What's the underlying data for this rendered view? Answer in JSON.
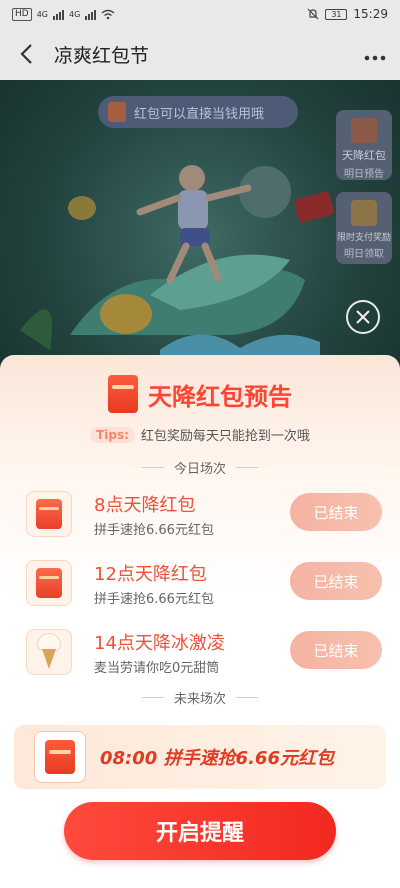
{
  "status_bar": {
    "network_badge": "HD",
    "sim_a": "4G",
    "sim_b": "4G",
    "battery": "31",
    "time": "15:29"
  },
  "navbar": {
    "title": "凉爽红包节",
    "more_icon": "ellipsis-icon",
    "back_icon": "chevron-left-icon"
  },
  "banner": {
    "pill_text": "红包可以直接当钱用哦",
    "side_cards": [
      {
        "line1": "天降红包",
        "line2": "明日预告"
      },
      {
        "line1": "限时支付奖励",
        "line2": "明日领取"
      }
    ]
  },
  "sheet": {
    "title": "天降红包预告",
    "tips_tag": "Tips:",
    "tips_text": "红包奖励每天只能抢到一次哦",
    "today_label": "今日场次",
    "future_label": "未来场次",
    "sessions": [
      {
        "name": "8点天降红包",
        "sub": "拼手速抢6.66元红包",
        "button": "已结束",
        "thumb": "red-envelope-icon"
      },
      {
        "name": "12点天降红包",
        "sub": "拼手速抢6.66元红包",
        "button": "已结束",
        "thumb": "red-envelope-icon"
      },
      {
        "name": "14点天降冰激凌",
        "sub": "麦当劳请你吃0元甜筒",
        "button": "已结束",
        "thumb": "ice-cream-icon"
      }
    ],
    "future_session": "08:00 拼手速抢6.66元红包",
    "cta": "开启提醒"
  },
  "colors": {
    "accent": "#ff4433",
    "ended_button": "#f6b3a2",
    "cta": "#f2281f"
  }
}
